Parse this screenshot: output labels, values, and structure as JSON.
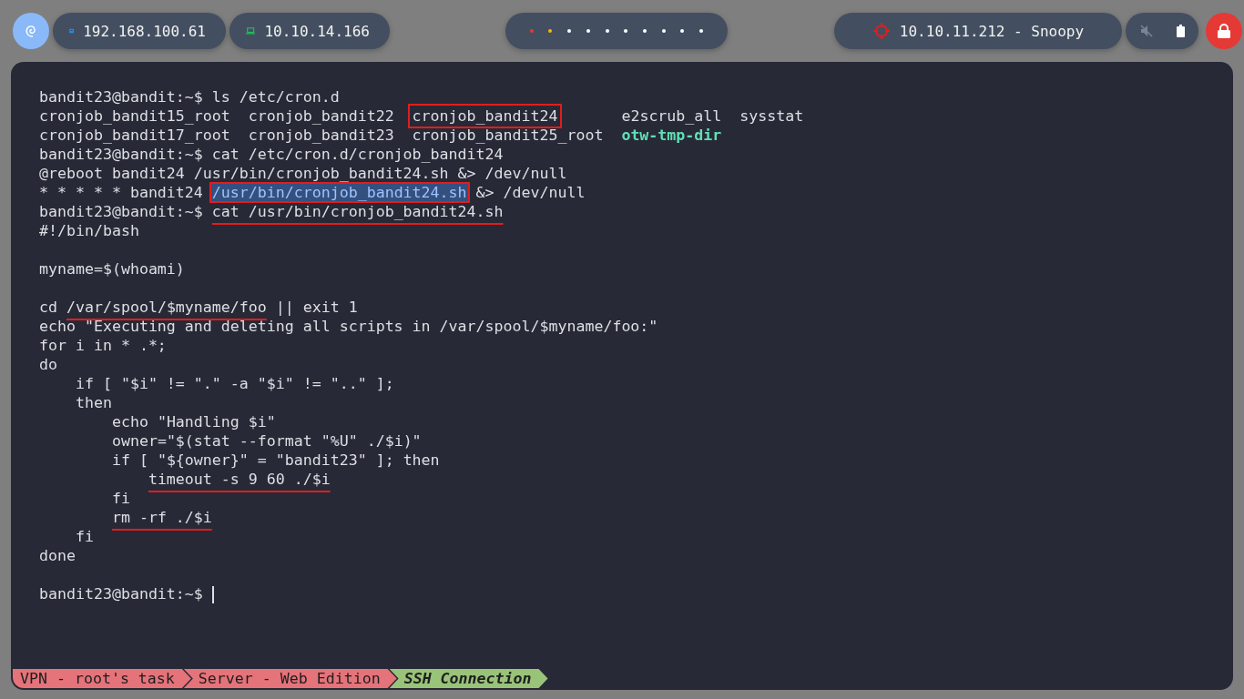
{
  "top_bar": {
    "hosts": [
      {
        "kind": "network",
        "label": "192.168.100.61"
      },
      {
        "kind": "laptop",
        "label": "10.10.14.166"
      }
    ],
    "workspaces": [
      {
        "color": "#e53935"
      },
      {
        "color": "#ffb300"
      },
      {
        "color": "#ffffff"
      },
      {
        "color": "#ffffff"
      },
      {
        "color": "#ffffff"
      },
      {
        "color": "#ffffff"
      },
      {
        "color": "#ffffff"
      },
      {
        "color": "#ffffff"
      },
      {
        "color": "#ffffff"
      },
      {
        "color": "#ffffff"
      }
    ],
    "target": {
      "label": "10.10.11.212 - Snoopy"
    }
  },
  "terminal": {
    "lines": [
      {
        "kind": "text",
        "segments": [
          {
            "kind": "plain",
            "text": "bandit23@bandit:~$ ls /etc/cron.d"
          }
        ]
      },
      {
        "kind": "text",
        "segments": [
          {
            "kind": "plain",
            "text": "cronjob_bandit15_root  cronjob_bandit22  "
          },
          {
            "kind": "boxed",
            "text": "cronjob_bandit24"
          },
          {
            "kind": "plain",
            "text": "       e2scrub_all  sysstat"
          }
        ]
      },
      {
        "kind": "text",
        "segments": [
          {
            "kind": "plain",
            "text": "cronjob_bandit17_root  cronjob_bandit23  cronjob_bandit25_root  "
          },
          {
            "kind": "directory",
            "text": "otw-tmp-dir"
          }
        ]
      },
      {
        "kind": "text",
        "segments": [
          {
            "kind": "plain",
            "text": "bandit23@bandit:~$ cat /etc/cron.d/cronjob_bandit24"
          }
        ]
      },
      {
        "kind": "text",
        "segments": [
          {
            "kind": "plain",
            "text": "@reboot bandit24 /usr/bin/cronjob_bandit24.sh &> /dev/null"
          }
        ]
      },
      {
        "kind": "text",
        "segments": [
          {
            "kind": "plain",
            "text": "* * * * * bandit24 "
          },
          {
            "kind": "selected",
            "text": "/usr/bin/cronjob_bandit24.sh"
          },
          {
            "kind": "plain",
            "text": " &> /dev/null"
          }
        ]
      },
      {
        "kind": "text",
        "segments": [
          {
            "kind": "plain",
            "text": "bandit23@bandit:~$ "
          },
          {
            "kind": "underlined",
            "text": "cat /usr/bin/cronjob_bandit24.sh"
          }
        ]
      },
      {
        "kind": "text",
        "segments": [
          {
            "kind": "plain",
            "text": "#!/bin/bash"
          }
        ]
      },
      {
        "kind": "blank"
      },
      {
        "kind": "text",
        "segments": [
          {
            "kind": "plain",
            "text": "myname=$(whoami)"
          }
        ]
      },
      {
        "kind": "blank"
      },
      {
        "kind": "text",
        "segments": [
          {
            "kind": "plain",
            "text": "cd "
          },
          {
            "kind": "underlined",
            "text": "/var/spool/$myname/foo"
          },
          {
            "kind": "plain",
            "text": " || exit 1"
          }
        ]
      },
      {
        "kind": "text",
        "segments": [
          {
            "kind": "plain",
            "text": "echo \"Executing and deleting all scripts in /var/spool/$myname/foo:\""
          }
        ]
      },
      {
        "kind": "text",
        "segments": [
          {
            "kind": "plain",
            "text": "for i in * .*;"
          }
        ]
      },
      {
        "kind": "text",
        "segments": [
          {
            "kind": "plain",
            "text": "do"
          }
        ]
      },
      {
        "kind": "text",
        "segments": [
          {
            "kind": "plain",
            "text": "    if [ \"$i\" != \".\" -a \"$i\" != \"..\" ];"
          }
        ]
      },
      {
        "kind": "text",
        "segments": [
          {
            "kind": "plain",
            "text": "    then"
          }
        ]
      },
      {
        "kind": "text",
        "segments": [
          {
            "kind": "plain",
            "text": "        echo \"Handling $i\""
          }
        ]
      },
      {
        "kind": "text",
        "segments": [
          {
            "kind": "plain",
            "text": "        owner=\"$(stat --format \"%U\" ./$i)\""
          }
        ]
      },
      {
        "kind": "text",
        "segments": [
          {
            "kind": "plain",
            "text": "        if [ \"${owner}\" = \"bandit23\" ]; then"
          }
        ]
      },
      {
        "kind": "text",
        "segments": [
          {
            "kind": "underlined",
            "text": "            timeout -s 9 60 ./$i"
          }
        ]
      },
      {
        "kind": "text",
        "segments": [
          {
            "kind": "plain",
            "text": "        fi"
          }
        ]
      },
      {
        "kind": "text",
        "segments": [
          {
            "kind": "underlined",
            "text": "        rm -rf ./$i"
          }
        ]
      },
      {
        "kind": "text",
        "segments": [
          {
            "kind": "plain",
            "text": "    fi"
          }
        ]
      },
      {
        "kind": "text",
        "segments": [
          {
            "kind": "plain",
            "text": "done"
          }
        ]
      },
      {
        "kind": "blank"
      },
      {
        "kind": "text",
        "segments": [
          {
            "kind": "plain",
            "text": "bandit23@bandit:~$ "
          },
          {
            "kind": "cursor"
          }
        ]
      }
    ]
  },
  "status_bar": [
    {
      "label": "VPN - root's task",
      "color": "#e5737a",
      "selected": false
    },
    {
      "label": "Server - Web Edition",
      "color": "#e5737a",
      "selected": false
    },
    {
      "label": "SSH Connection",
      "color": "#98c379",
      "selected": true
    }
  ]
}
